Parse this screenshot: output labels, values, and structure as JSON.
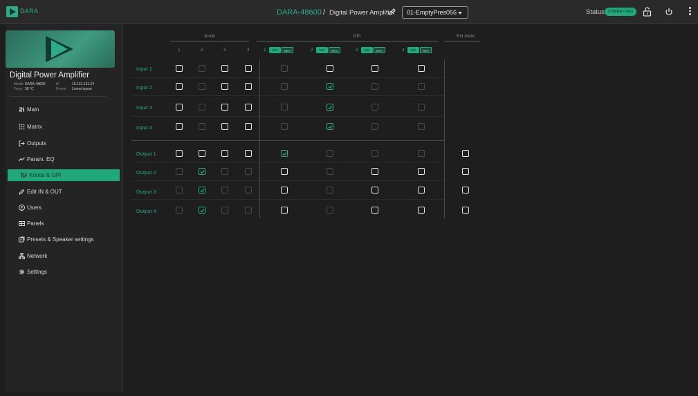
{
  "app": {
    "logo_text": "DARA",
    "device_model": "DARA-48600",
    "separator": "/",
    "device_name": "Digital Power Amplifier",
    "preset": "01-EmptyPres056",
    "status_label": "Status:",
    "status_value": "CONNECTED",
    "accent": "#1fa87a"
  },
  "device": {
    "title": "Digital Power Amplifier",
    "model_label": "Model",
    "model_value": "DARA-48600",
    "ip_label": "IP",
    "ip_value": "10.121.121.24",
    "temp_label": "Temp",
    "temp_value": "58 °C",
    "preset_label": "Preset",
    "preset_value": "Lorem ipsum"
  },
  "nav": [
    {
      "label": "Main",
      "icon": "sliders-icon"
    },
    {
      "label": "Matrix",
      "icon": "grid-icon"
    },
    {
      "label": "Outputs",
      "icon": "output-arrow-icon"
    },
    {
      "label": "Param. EQ",
      "icon": "eq-curve-icon"
    },
    {
      "label": "Knobs & GPI",
      "icon": "knobs-icon",
      "active": true
    },
    {
      "label": "Edit IN & OUT",
      "icon": "pencil-icon"
    },
    {
      "label": "Users",
      "icon": "users-icon"
    },
    {
      "label": "Panels",
      "icon": "panel-icon"
    },
    {
      "label": "Presets  & Speaker settings",
      "icon": "presets-icon"
    },
    {
      "label": "Network",
      "icon": "network-icon"
    },
    {
      "label": "Settings",
      "icon": "gear-icon"
    }
  ],
  "matrix": {
    "knob_header": "Knob",
    "gpi_header": "GPI",
    "ext_header": "Ext mute",
    "knob_cols": [
      "1",
      "2",
      "3",
      "4"
    ],
    "gpi_cols": [
      "1",
      "2",
      "3",
      "4"
    ],
    "dir_label": "DIR",
    "rev_label": "REV",
    "rows": [
      {
        "label": "Input 1",
        "cells": [
          "on",
          "dim",
          "on",
          "on",
          "dim",
          "on",
          "on",
          "on"
        ],
        "ext": null
      },
      {
        "label": "Input 2",
        "cells": [
          "on",
          "dim",
          "on",
          "on",
          "dim",
          "chk",
          "dim",
          "dim"
        ],
        "ext": null
      },
      {
        "label": "Input 3",
        "cells": [
          "on",
          "dim",
          "on",
          "on",
          "dim",
          "chk",
          "dim",
          "dim"
        ],
        "ext": null
      },
      {
        "label": "Input 4",
        "cells": [
          "on",
          "dim",
          "on",
          "on",
          "dim",
          "chk",
          "dim",
          "dim"
        ],
        "ext": null
      },
      {
        "label": "Output 1",
        "cells": [
          "on",
          "on",
          "on",
          "on",
          "chk",
          "dim",
          "dim",
          "dim"
        ],
        "ext": "on"
      },
      {
        "label": "Output 2",
        "cells": [
          "dim",
          "chk",
          "dim",
          "dim",
          "on",
          "dim",
          "on",
          "on"
        ],
        "ext": "on"
      },
      {
        "label": "Output 3",
        "cells": [
          "dim",
          "chk",
          "dim",
          "dim",
          "on",
          "dim",
          "on",
          "on"
        ],
        "ext": "on"
      },
      {
        "label": "Output 4",
        "cells": [
          "dim",
          "chk",
          "dim",
          "dim",
          "on",
          "dim",
          "on",
          "on"
        ],
        "ext": "on"
      }
    ]
  }
}
